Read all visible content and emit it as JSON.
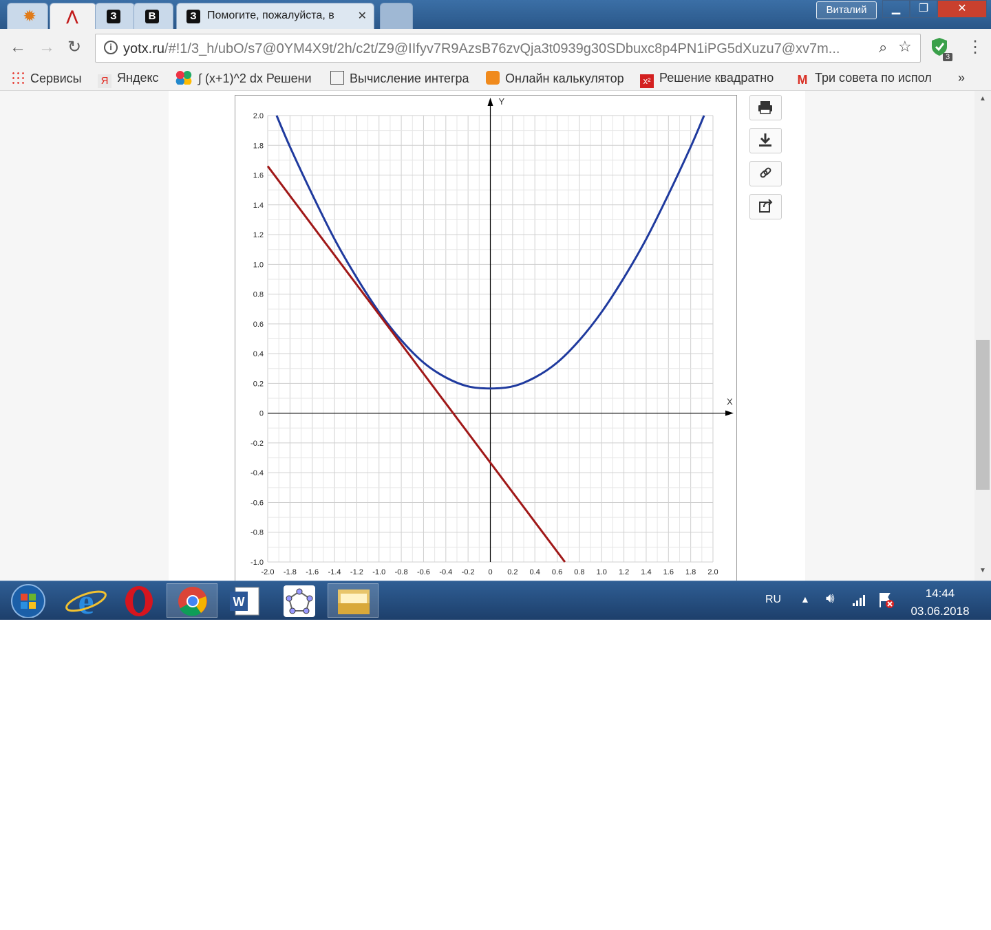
{
  "browser": {
    "active_tab_title": "Помогите, пожалуйста, в",
    "user_name": "Виталий",
    "url_host": "yotx.ru",
    "url_rest": "/#!1/3_h/ubO/s7@0YM4X9t/2h/c2t/Z9@IIfyv7R9AzsB76zvQja3t0939g30SDbuxc8p4PN1iPG5dXuzu7@xv7m...",
    "extension_badge": "3",
    "bookmarks": [
      "Сервисы",
      "Яндекс",
      "∫ (x+1)^2 dx Решени",
      "Вычисление интегра",
      "Онлайн калькулятор",
      "Решение квадратно",
      "Три совета по испол"
    ],
    "bookmarks_more": "»"
  },
  "chart_data": {
    "type": "line",
    "xlabel": "X",
    "ylabel": "Y",
    "xlim": [
      -2.0,
      2.0
    ],
    "ylim": [
      -1.0,
      2.0
    ],
    "xticks": [
      "-2.0",
      "-1.8",
      "-1.6",
      "-1.4",
      "-1.2",
      "-1.0",
      "-0.8",
      "-0.6",
      "-0.4",
      "-0.2",
      "0",
      "0.2",
      "0.4",
      "0.6",
      "0.8",
      "1.0",
      "1.2",
      "1.4",
      "1.6",
      "1.8",
      "2.0"
    ],
    "yticks": [
      "2.0",
      "1.8",
      "1.6",
      "1.4",
      "1.2",
      "1.0",
      "0.8",
      "0.6",
      "0.4",
      "0.2",
      "0",
      "-0.2",
      "-0.4",
      "-0.6",
      "-0.8",
      "-1.0"
    ],
    "grid": true,
    "series": [
      {
        "color": "#1f3a9e",
        "x": [
          -1.92,
          -1.8,
          -1.6,
          -1.4,
          -1.2,
          -1.0,
          -0.8,
          -0.6,
          -0.4,
          -0.2,
          0,
          0.2,
          0.4,
          0.6,
          0.8,
          1.0,
          1.2,
          1.4,
          1.6,
          1.8,
          1.92
        ],
        "y": [
          2.0,
          1.79,
          1.47,
          1.17,
          0.91,
          0.68,
          0.49,
          0.34,
          0.24,
          0.18,
          0.166,
          0.18,
          0.24,
          0.34,
          0.49,
          0.68,
          0.91,
          1.17,
          1.47,
          1.79,
          2.0
        ]
      },
      {
        "color": "#a01818",
        "x": [
          -2.0,
          0.67
        ],
        "y": [
          1.66,
          -1.0
        ]
      }
    ]
  },
  "taskbar": {
    "language": "RU",
    "time": "14:44",
    "date": "03.06.2018"
  }
}
